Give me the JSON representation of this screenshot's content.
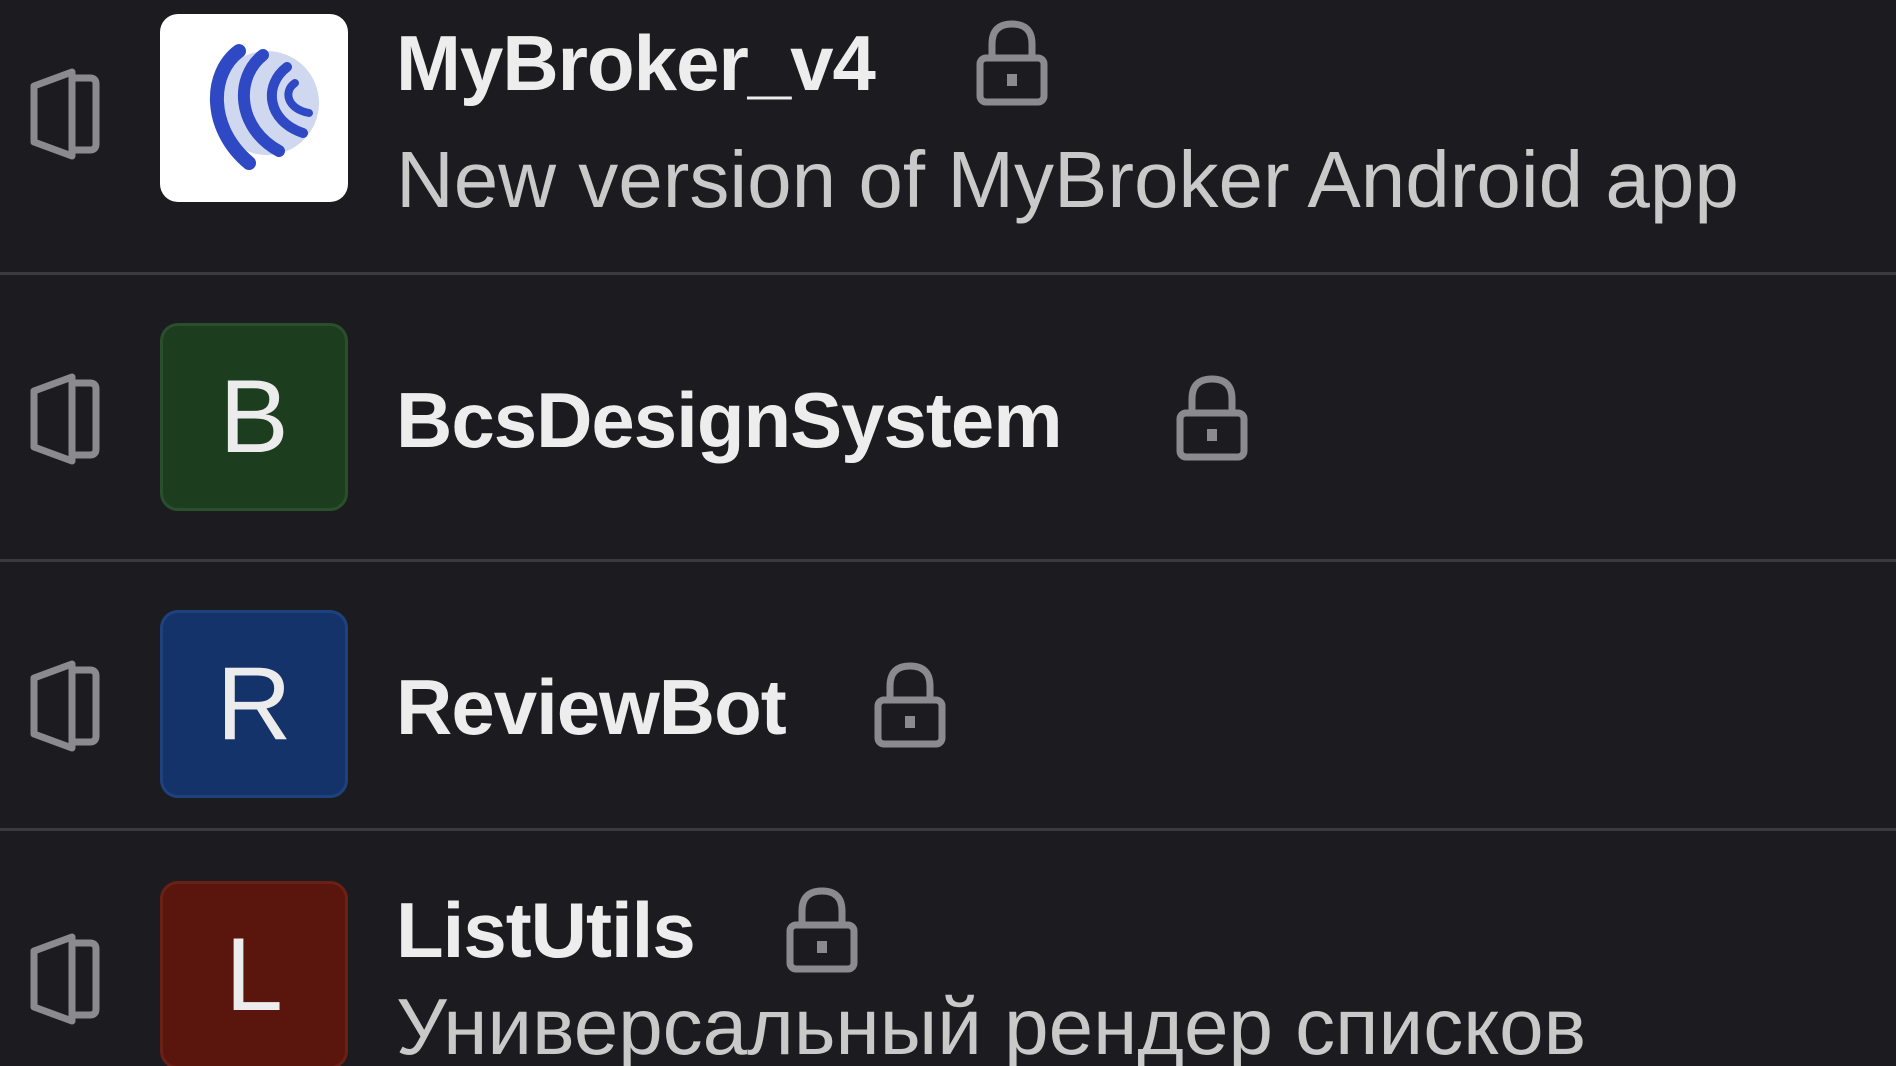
{
  "repositories": [
    {
      "name": "MyBroker_v4",
      "description": "New version of MyBroker Android app",
      "avatar_letter": "",
      "avatar_color": "#ffffff",
      "private": true
    },
    {
      "name": "BcsDesignSystem",
      "description": "",
      "avatar_letter": "B",
      "avatar_color": "#1d3d1f",
      "private": true
    },
    {
      "name": "ReviewBot",
      "description": "",
      "avatar_letter": "R",
      "avatar_color": "#15336b",
      "private": true
    },
    {
      "name": "ListUtils",
      "description": "Универсальный рендер списков",
      "avatar_letter": "L",
      "avatar_color": "#5a150c",
      "private": true
    }
  ],
  "icons": {
    "repo_type": "book-icon",
    "private": "lock-icon",
    "app_logo": "globe-logo-icon"
  },
  "colors": {
    "background": "#1c1c20",
    "divider": "#3a3a40",
    "text_primary": "#ededed",
    "text_secondary": "#c9c9c9",
    "icon_muted": "#8a8a8f"
  }
}
